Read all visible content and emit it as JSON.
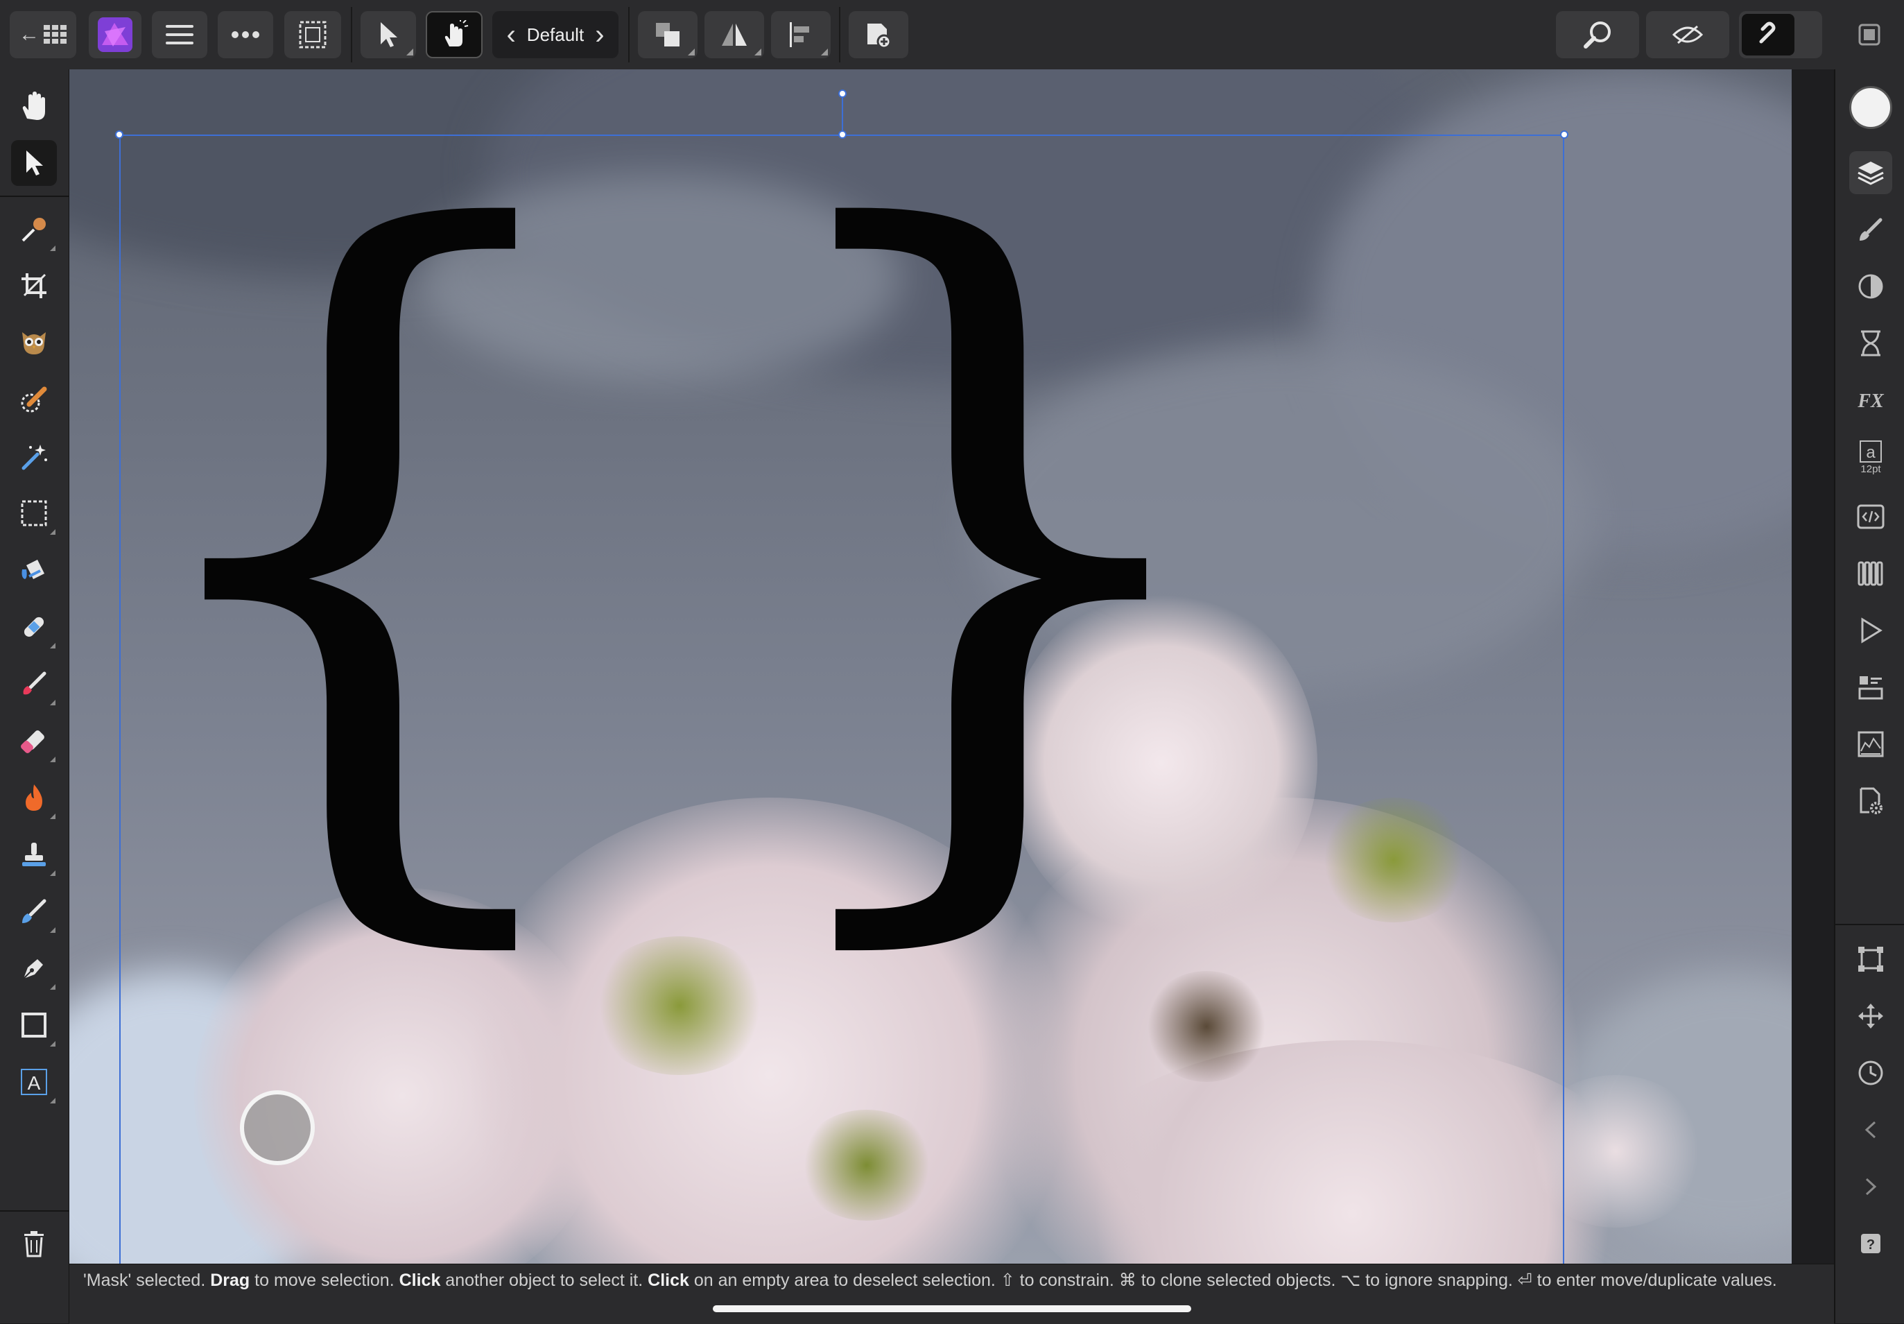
{
  "toolbar": {
    "back_label": "←",
    "persona_label": "Default",
    "persona_prev": "‹",
    "persona_next": "›"
  },
  "canvas": {
    "text_layer": "{ }",
    "left_brace": "{",
    "right_brace": "}"
  },
  "right_panel": {
    "character_size_label": "12pt"
  },
  "status": {
    "part1": "'Mask' selected. ",
    "drag": "Drag",
    "part2": " to move selection. ",
    "click1": "Click",
    "part3": " another object to select it. ",
    "click2": "Click",
    "part4": " on an empty area to deselect selection. ⇧ to constrain. ⌘ to clone selected objects. ⌥ to ignore snapping. ⏎ to enter move/duplicate values."
  },
  "colors": {
    "ui_bg": "#2b2b2d",
    "selection": "#3d6fd6",
    "affinity_logo": "#a94cf0"
  },
  "icons": {
    "left_tools": [
      "hand-icon",
      "move-icon",
      "color-picker-icon",
      "crop-icon",
      "liquify-icon",
      "selection-brush-icon",
      "magic-wand-icon",
      "marquee-icon",
      "flood-fill-icon",
      "inpainting-icon",
      "paint-brush-icon",
      "erase-brush-icon",
      "burn-icon",
      "clone-icon",
      "smudge-icon",
      "pen-icon",
      "rectangle-icon",
      "text-icon",
      "trash-icon"
    ],
    "right_tools": [
      "color-swatch-icon",
      "layers-icon",
      "brushes-icon",
      "adjustments-icon",
      "history-icon",
      "effects-icon",
      "character-icon",
      "text-styles-icon",
      "swatches-icon",
      "navigator-icon",
      "channels-icon",
      "histogram-icon",
      "settings-icon",
      "transform-icon",
      "move-panel-icon",
      "snapshots-icon",
      "previous-icon",
      "next-icon",
      "help-icon"
    ]
  }
}
